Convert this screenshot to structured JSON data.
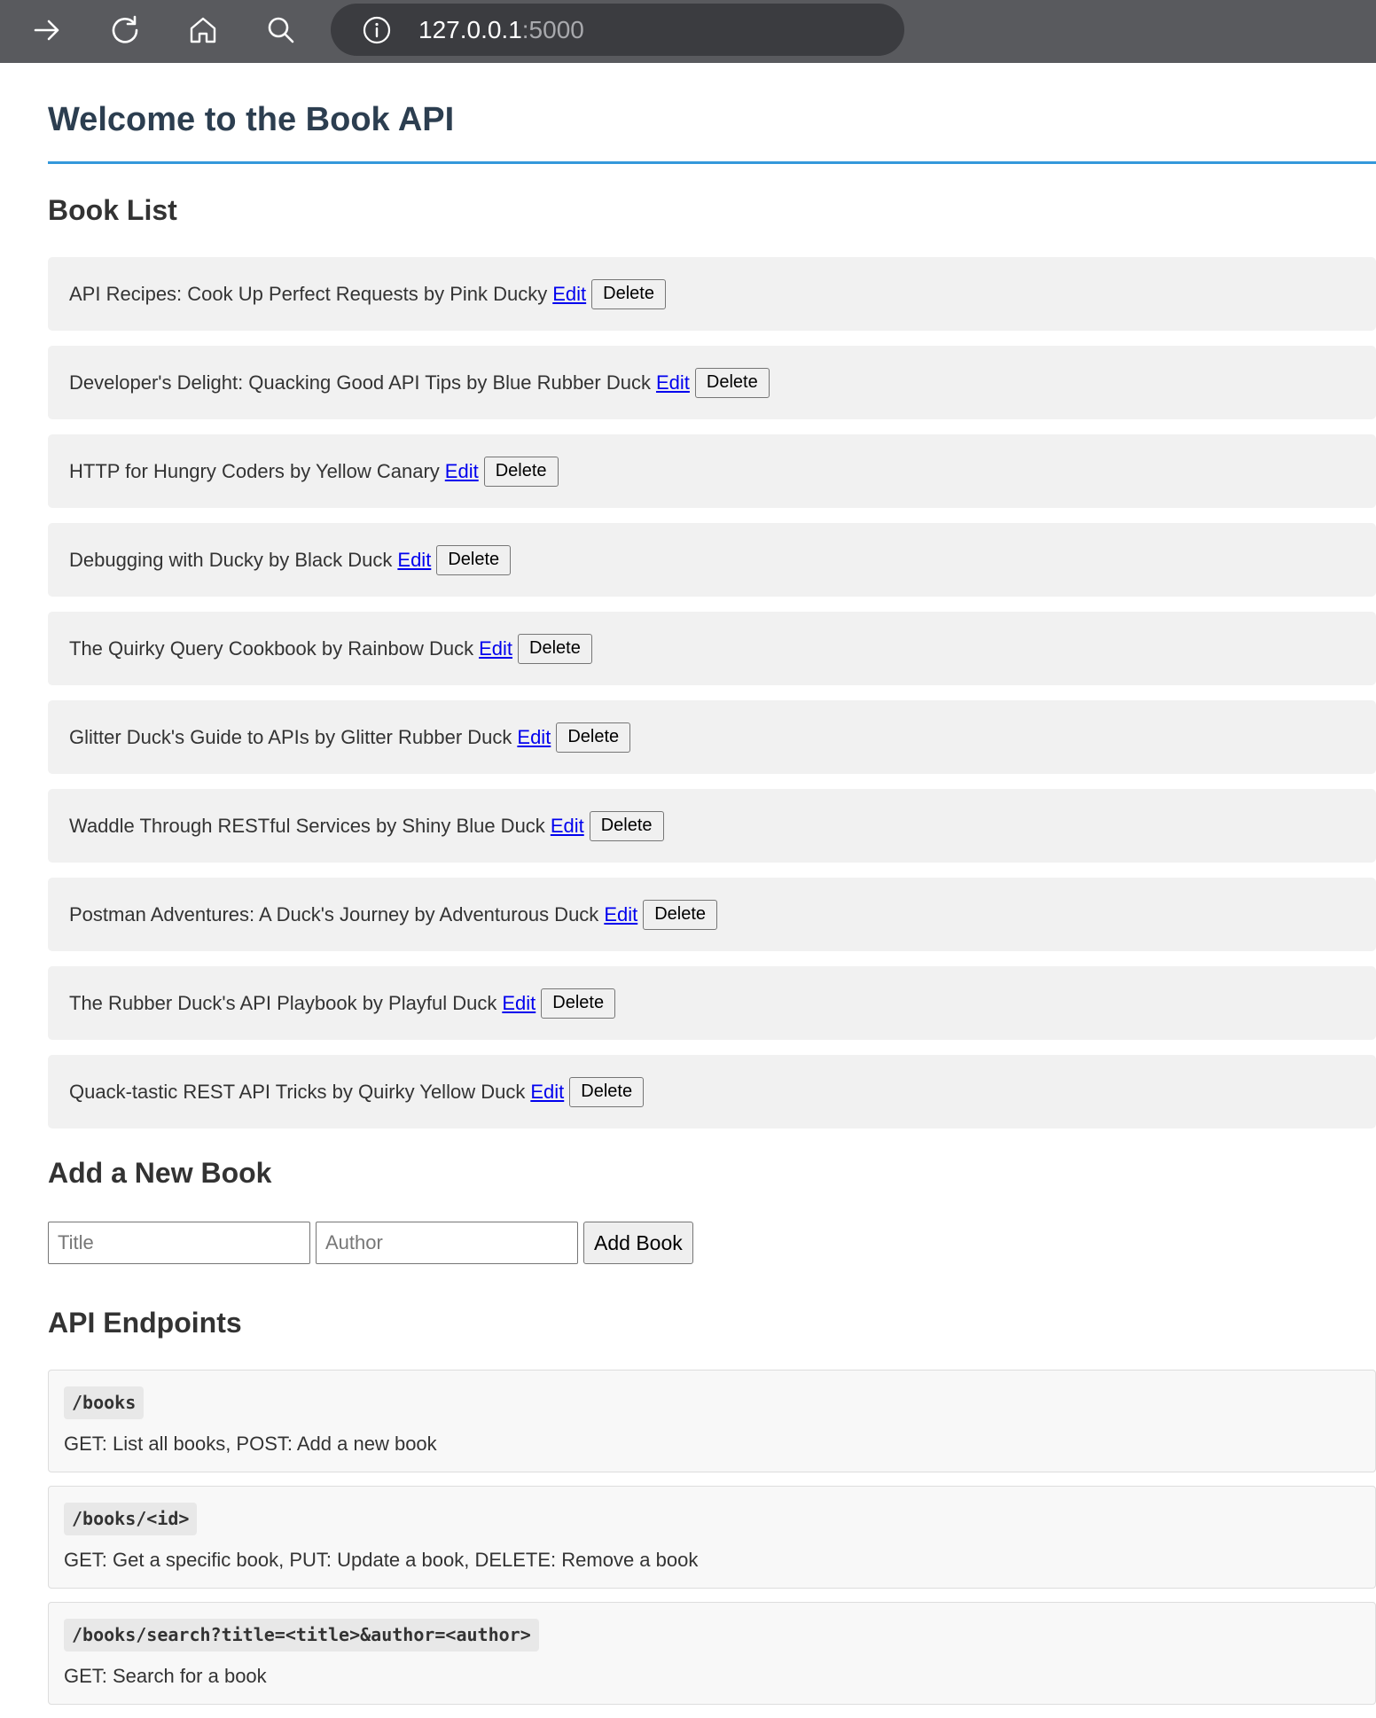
{
  "browser": {
    "address_host": "127.0.0.1",
    "address_port": ":5000",
    "icons": [
      "forward-arrow-icon",
      "reload-icon",
      "home-icon",
      "search-icon",
      "info-icon"
    ]
  },
  "page": {
    "title": "Welcome to the Book API",
    "accent_color": "#3498db",
    "title_color": "#2c3e50"
  },
  "book_list": {
    "heading": "Book List",
    "edit_label": "Edit",
    "delete_label": "Delete",
    "books": [
      {
        "text": "API Recipes: Cook Up Perfect Requests by Pink Ducky"
      },
      {
        "text": "Developer's Delight: Quacking Good API Tips by Blue Rubber Duck"
      },
      {
        "text": "HTTP for Hungry Coders by Yellow Canary"
      },
      {
        "text": "Debugging with Ducky by Black Duck"
      },
      {
        "text": "The Quirky Query Cookbook by Rainbow Duck"
      },
      {
        "text": "Glitter Duck's Guide to APIs by Glitter Rubber Duck"
      },
      {
        "text": "Waddle Through RESTful Services by Shiny Blue Duck"
      },
      {
        "text": "Postman Adventures: A Duck's Journey by Adventurous Duck"
      },
      {
        "text": "The Rubber Duck's API Playbook by Playful Duck"
      },
      {
        "text": "Quack-tastic REST API Tricks by Quirky Yellow Duck"
      }
    ]
  },
  "add_book": {
    "heading": "Add a New Book",
    "title_placeholder": "Title",
    "title_value": "",
    "author_placeholder": "Author",
    "author_value": "",
    "button_label": "Add Book"
  },
  "api_endpoints": {
    "heading": "API Endpoints",
    "items": [
      {
        "path": "/books",
        "description": "GET: List all books, POST: Add a new book"
      },
      {
        "path": "/books/<id>",
        "description": "GET: Get a specific book, PUT: Update a book, DELETE: Remove a book"
      },
      {
        "path": "/books/search?title=<title>&author=<author>",
        "description": "GET: Search for a book"
      }
    ]
  }
}
